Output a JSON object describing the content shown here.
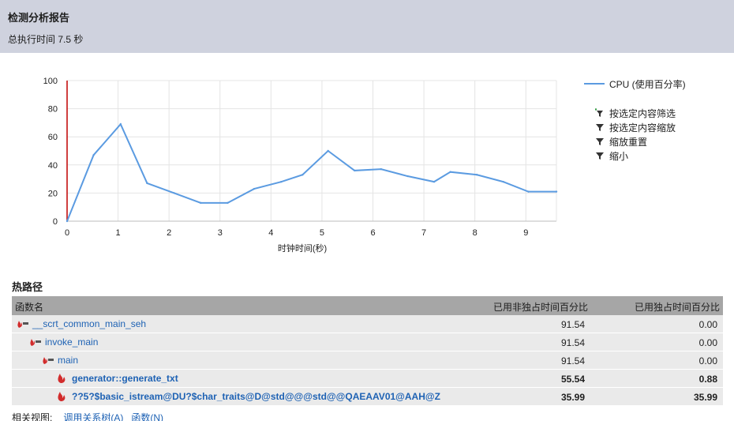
{
  "header": {
    "title": "检测分析报告",
    "subtitle": "总执行时间 7.5 秒"
  },
  "chart_data": {
    "type": "line",
    "xlabel": "时钟时间(秒)",
    "ylabel": "",
    "xlim": [
      0,
      9.6
    ],
    "ylim": [
      0,
      100
    ],
    "xticks": [
      0,
      1,
      2,
      3,
      4,
      5,
      6,
      7,
      8,
      9
    ],
    "yticks": [
      0,
      20,
      40,
      60,
      80,
      100
    ],
    "grid": true,
    "legend": "right",
    "series": [
      {
        "name": "CPU (使用百分率)",
        "color": "#5b9be1",
        "x": [
          0,
          0.52,
          1.05,
          1.57,
          2.1,
          2.62,
          3.15,
          3.67,
          4.2,
          4.62,
          5.12,
          5.64,
          6.16,
          6.68,
          7.2,
          7.52,
          8.04,
          8.56,
          9.05,
          9.6
        ],
        "y": [
          0,
          47,
          69,
          27,
          20,
          13,
          13,
          23,
          28,
          33,
          50,
          36,
          37,
          32,
          28,
          35,
          33,
          28,
          21,
          21
        ]
      }
    ],
    "marker_line": {
      "x": 0,
      "color": "#c00000"
    }
  },
  "legend_actions": [
    "按选定内容筛选",
    "按选定内容缩放",
    "缩放重置",
    "缩小"
  ],
  "hotpath": {
    "title": "热路径",
    "columns": [
      "函数名",
      "已用非独占时间百分比",
      "已用独占时间百分比"
    ],
    "rows": [
      {
        "name": "__scrt_common_main_seh",
        "inclusive": "91.54",
        "exclusive": "0.00"
      },
      {
        "name": "invoke_main",
        "inclusive": "91.54",
        "exclusive": "0.00"
      },
      {
        "name": "main",
        "inclusive": "91.54",
        "exclusive": "0.00"
      },
      {
        "name": "generator::generate_txt",
        "inclusive": "55.54",
        "exclusive": "0.88"
      },
      {
        "name": "??5?$basic_istream@DU?$char_traits@D@std@@@std@@QAEAAV01@AAH@Z",
        "inclusive": "35.99",
        "exclusive": "35.99"
      }
    ]
  },
  "footer": {
    "label": "相关视图:",
    "links": [
      "调用关系树(A)",
      "函数(N)"
    ]
  }
}
